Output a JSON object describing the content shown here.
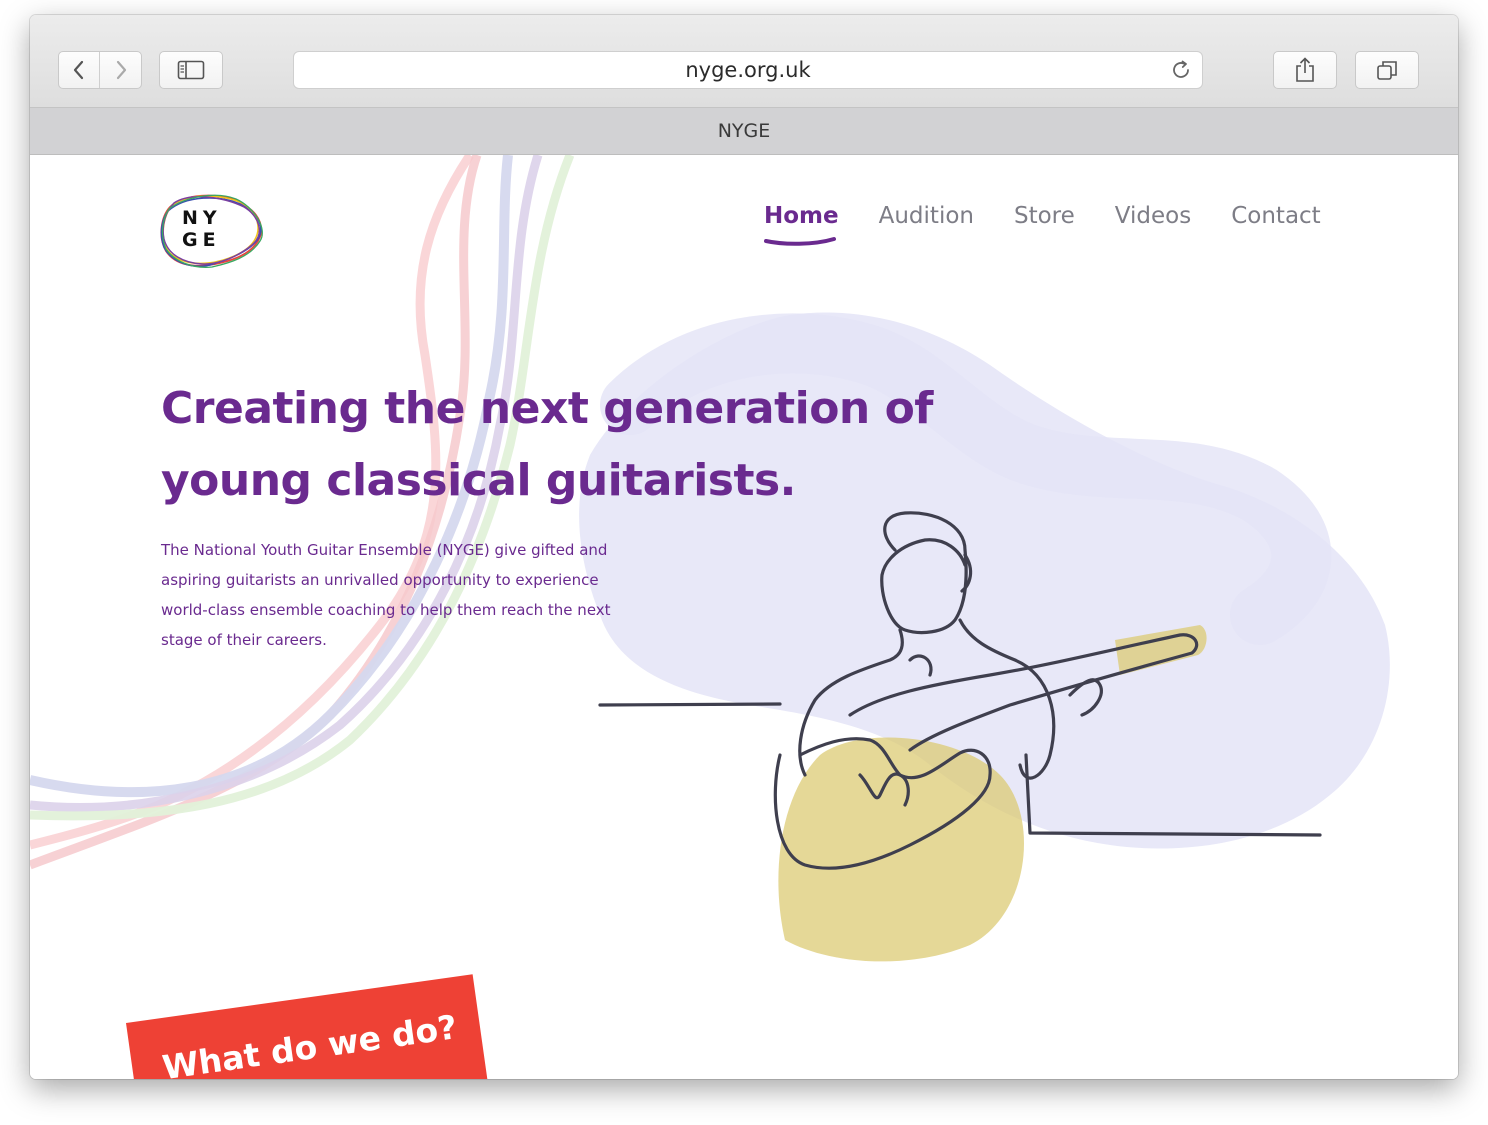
{
  "browser": {
    "url": "nyge.org.uk",
    "tab_title": "NYGE"
  },
  "site": {
    "logo_text": "NY GE",
    "nav": [
      {
        "label": "Home",
        "active": true
      },
      {
        "label": "Audition",
        "active": false
      },
      {
        "label": "Store",
        "active": false
      },
      {
        "label": "Videos",
        "active": false
      },
      {
        "label": "Contact",
        "active": false
      }
    ],
    "headline": "Creating the next generation of young classical guitarists.",
    "intro": "The National Youth Guitar Ensemble (NYGE) give gifted and aspiring guitarists an unrivalled opportunity to experience world-class ensemble coaching to help them reach the next stage of their careers.",
    "section_banner": "What do we do?"
  },
  "colors": {
    "brand_purple": "#6a2a8f",
    "banner_red": "#ee4135",
    "nav_gray": "#7d7d86",
    "wash_lavender": "#e8e8f8",
    "guitar_ochre": "#d8c46a"
  },
  "icons": [
    "back-arrow-icon",
    "forward-arrow-icon",
    "sidebar-icon",
    "reload-icon",
    "share-icon",
    "tabs-icon",
    "guitarist-illustration"
  ]
}
